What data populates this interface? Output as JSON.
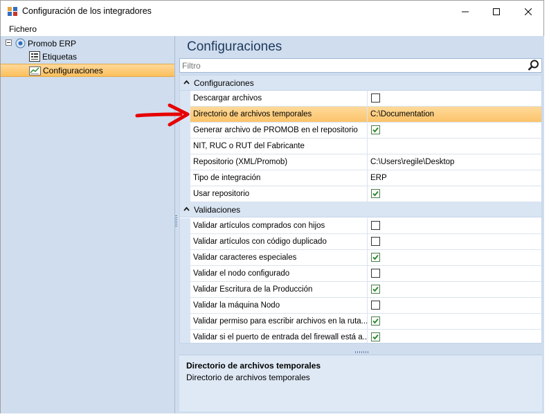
{
  "window": {
    "title": "Configuración de los integradores"
  },
  "menu": {
    "items": [
      "Fichero"
    ]
  },
  "tree": {
    "root": "Promob ERP",
    "children": [
      "Etiquetas",
      "Configuraciones"
    ],
    "selected": "Configuraciones"
  },
  "main": {
    "header": "Configuraciones",
    "filter_placeholder": "Filtro"
  },
  "property_grid": {
    "categories": [
      {
        "label": "Configuraciones",
        "properties": [
          {
            "name": "Descargar archivos",
            "value": "",
            "type": "checkbox",
            "checked": false
          },
          {
            "name": "Directorio de archivos temporales",
            "value": "C:\\Documentation",
            "type": "text",
            "selected": true
          },
          {
            "name": "Generar archivo de PROMOB en el repositorio",
            "value": "",
            "type": "checkbox",
            "checked": true
          },
          {
            "name": "NIT, RUC o RUT del Fabricante",
            "value": "",
            "type": "text"
          },
          {
            "name": "Repositorio (XML/Promob)",
            "value": "C:\\Users\\regile\\Desktop",
            "type": "text"
          },
          {
            "name": "Tipo de integración",
            "value": "ERP",
            "type": "text"
          },
          {
            "name": "Usar repositorio",
            "value": "",
            "type": "checkbox",
            "checked": true
          }
        ]
      },
      {
        "label": "Validaciones",
        "properties": [
          {
            "name": "Validar artículos comprados con hijos",
            "value": "",
            "type": "checkbox",
            "checked": false
          },
          {
            "name": "Validar artículos con código duplicado",
            "value": "",
            "type": "checkbox",
            "checked": false
          },
          {
            "name": "Validar caracteres especiales",
            "value": "",
            "type": "checkbox",
            "checked": true
          },
          {
            "name": "Validar el nodo configurado",
            "value": "",
            "type": "checkbox",
            "checked": false
          },
          {
            "name": "Validar Escritura de la Producción",
            "value": "",
            "type": "checkbox",
            "checked": true
          },
          {
            "name": "Validar la máquina Nodo",
            "value": "",
            "type": "checkbox",
            "checked": false
          },
          {
            "name": "Validar permiso para escribir archivos en la ruta...",
            "value": "",
            "type": "checkbox",
            "checked": true
          },
          {
            "name": "Validar si el puerto de entrada del firewall está a...",
            "value": "",
            "type": "checkbox",
            "checked": true
          }
        ]
      }
    ]
  },
  "description": {
    "title": "Directorio de archivos temporales",
    "text": "Directorio de archivos temporales"
  },
  "colors": {
    "selection": "#fbbf5c",
    "pane_background": "#cfddee",
    "header_text": "#1e395b",
    "arrow": "#e60000",
    "check": "#2e8b2e"
  }
}
